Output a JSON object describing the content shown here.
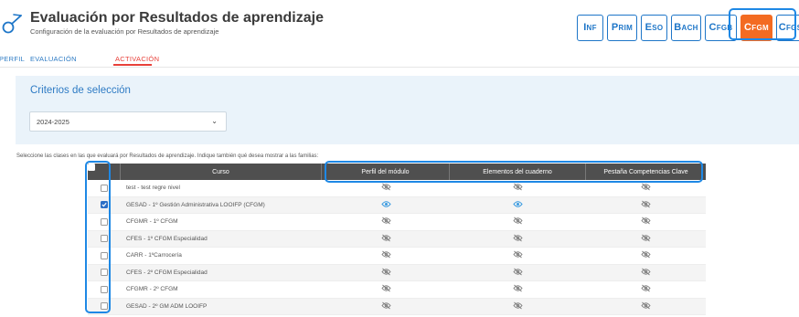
{
  "header": {
    "title": "Evaluación por Resultados de aprendizaje",
    "subtitle": "Configuración de la evaluación por Resultados de aprendizaje",
    "levels": [
      {
        "first": "I",
        "rest": "NF",
        "active": false
      },
      {
        "first": "P",
        "rest": "RIM",
        "active": false
      },
      {
        "first": "E",
        "rest": "SO",
        "active": false
      },
      {
        "first": "B",
        "rest": "ACH",
        "active": false
      },
      {
        "first": "C",
        "rest": "FGB",
        "active": false
      },
      {
        "first": "C",
        "rest": "FGM",
        "active": true
      },
      {
        "first": "C",
        "rest": "FGS",
        "active": false
      }
    ]
  },
  "tabs": [
    "PERFIL",
    "EVALUACIÓN",
    "ACTIVACIÓN"
  ],
  "active_tab": "ACTIVACIÓN",
  "criteria": {
    "title": "Criterios de selección",
    "year_select": "2024-2025"
  },
  "instructions": "Seleccione las clases en las que evaluará por Resultados de aprendizaje. Indique también qué desea mostrar a las familias:",
  "table": {
    "headers": [
      "Curso",
      "Perfil del módulo",
      "Elementos del cuaderno",
      "Pestaña Competencias Clave"
    ],
    "rows": [
      {
        "curso": "test - test regre nivel",
        "checked": false,
        "perfil": "eye-off-icon",
        "elementos": "eye-off-icon",
        "pestana": "eye-off-icon"
      },
      {
        "curso": "GESAD - 1º Gestión Administrativa LOOIFP (CFGM)",
        "checked": true,
        "perfil": "eye-icon",
        "elementos": "eye-icon",
        "pestana": "eye-off-icon"
      },
      {
        "curso": "CFGMR - 1º CFGM",
        "checked": false,
        "perfil": "eye-off-icon",
        "elementos": "eye-off-icon",
        "pestana": "eye-off-icon"
      },
      {
        "curso": "CFES - 1º CFGM Especialidad",
        "checked": false,
        "perfil": "eye-off-icon",
        "elementos": "eye-off-icon",
        "pestana": "eye-off-icon"
      },
      {
        "curso": "CARR - 1ºCarrocería",
        "checked": false,
        "perfil": "eye-off-icon",
        "elementos": "eye-off-icon",
        "pestana": "eye-off-icon"
      },
      {
        "curso": "CFES - 2º CFGM Especialidad",
        "checked": false,
        "perfil": "eye-off-icon",
        "elementos": "eye-off-icon",
        "pestana": "eye-off-icon"
      },
      {
        "curso": "CFGMR - 2º CFGM",
        "checked": false,
        "perfil": "eye-off-icon",
        "elementos": "eye-off-icon",
        "pestana": "eye-off-icon"
      },
      {
        "curso": "GESAD - 2º GM ADM LOOIFP",
        "checked": false,
        "perfil": "eye-off-icon",
        "elementos": "eye-off-icon",
        "pestana": "eye-off-icon"
      }
    ]
  },
  "colors": {
    "accent": "#2e7bc4",
    "active_level": "#f36b22",
    "active_tab": "#e8413a",
    "highlight": "#1e88e5",
    "eye_on": "#3b9be0",
    "eye_off": "#777777"
  }
}
